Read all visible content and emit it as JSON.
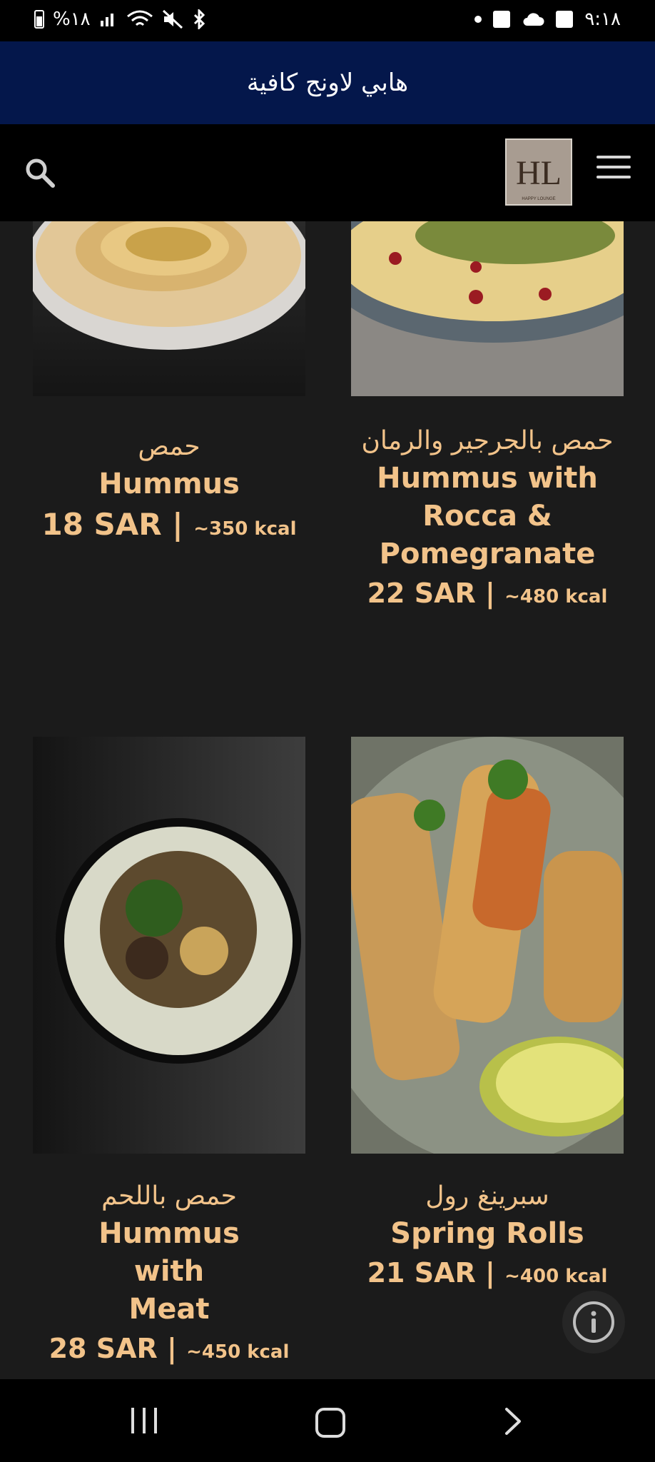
{
  "status_bar": {
    "battery_text": "%١٨",
    "time": "٩:١٨"
  },
  "app": {
    "title": "هابي لاونج كافية"
  },
  "header": {
    "logo_text": "HL",
    "logo_caption": "HAPPY LOUNGE"
  },
  "menu_items": [
    {
      "name_ar": "حمص",
      "name_en": "Hummus",
      "price": "18 SAR",
      "separator": "|",
      "kcal": "~350 kcal"
    },
    {
      "name_ar": "حمص بالجرجير والرمان",
      "name_en": "Hummus with Rocca & Pomegranate",
      "price": "22 SAR",
      "separator": "|",
      "kcal": "~480 kcal"
    },
    {
      "name_ar": "حمص باللحم",
      "name_en": "Hummus with Meat",
      "price": "28 SAR",
      "separator": "|",
      "kcal": "~450 kcal"
    },
    {
      "name_ar": "سبرينغ رول",
      "name_en": "Spring Rolls",
      "price": "21 SAR",
      "separator": "|",
      "kcal": "~400 kcal"
    }
  ],
  "icons": {
    "search": "search-icon",
    "menu": "hamburger-menu-icon",
    "info": "info-icon",
    "nav_recent": "recent-apps-icon",
    "nav_home": "home-icon",
    "nav_back": "back-icon"
  }
}
